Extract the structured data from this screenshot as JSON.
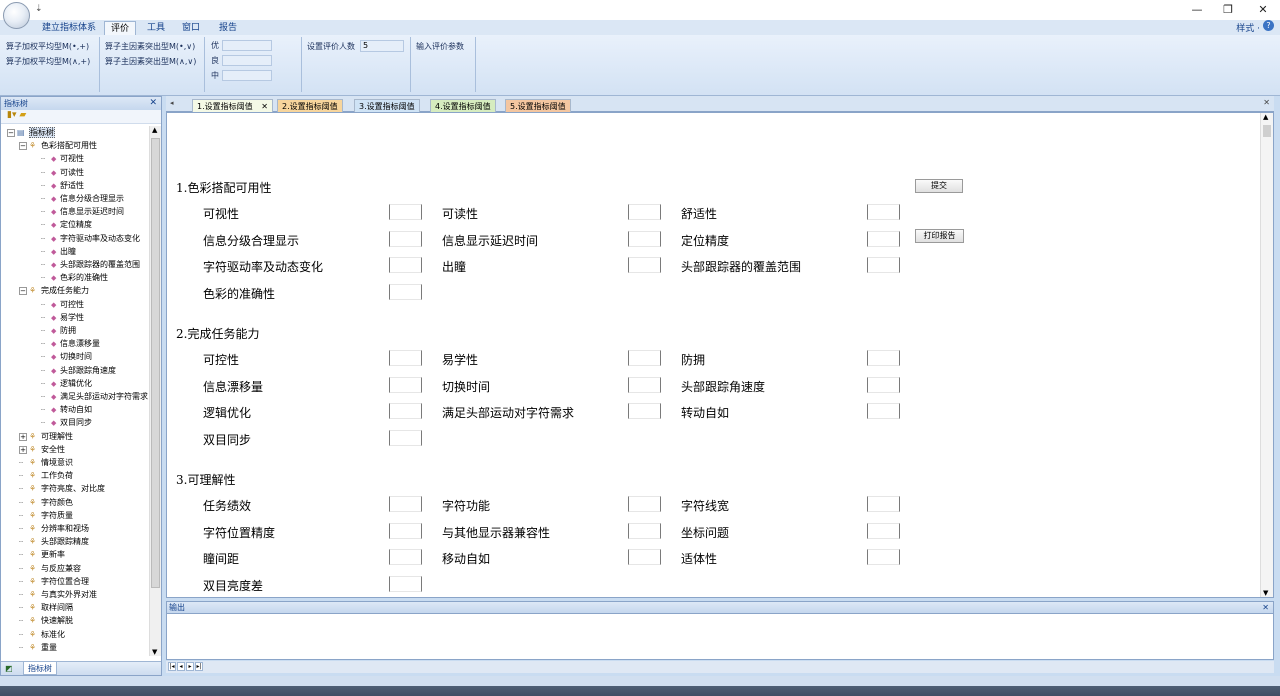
{
  "titlebar": {
    "qat_symbol": "⇣",
    "minimize": "—",
    "maximize": "❐",
    "close": "✕"
  },
  "ribbon_tabs": [
    "建立指标体系",
    "评价",
    "工具",
    "窗口",
    "报告"
  ],
  "style_menu": "样式 ·",
  "help_label": "?",
  "ribbon": {
    "ops": [
      "算子加权平均型M(•,+)",
      "算子加权平均型M(∧,+)",
      "算子主因素突出型M(•,∨)",
      "算子主因素突出型M(∧,∨)"
    ],
    "eval_levels": [
      "优",
      "良",
      "中"
    ],
    "eval_count_label": "设置评价人数",
    "eval_count_value": "5",
    "eval_params": "输入评价参数"
  },
  "left_panel": {
    "title": "指标树",
    "close": "✕",
    "bottom_tab": "指标树",
    "tree": [
      {
        "label": "指标树",
        "level": 0,
        "kind": "root"
      },
      {
        "label": "色彩搭配可用性",
        "level": 1,
        "kind": "group"
      },
      {
        "label": "可视性",
        "level": 2,
        "kind": "leaf"
      },
      {
        "label": "可读性",
        "level": 2,
        "kind": "leaf"
      },
      {
        "label": "舒适性",
        "level": 2,
        "kind": "leaf"
      },
      {
        "label": "信息分级合理显示",
        "level": 2,
        "kind": "leaf"
      },
      {
        "label": "信息显示延迟时间",
        "level": 2,
        "kind": "leaf"
      },
      {
        "label": "定位精度",
        "level": 2,
        "kind": "leaf"
      },
      {
        "label": "字符驱动率及动态变化",
        "level": 2,
        "kind": "leaf"
      },
      {
        "label": "出瞳",
        "level": 2,
        "kind": "leaf"
      },
      {
        "label": "头部跟踪器的覆盖范围",
        "level": 2,
        "kind": "leaf"
      },
      {
        "label": "色彩的准确性",
        "level": 2,
        "kind": "leaf"
      },
      {
        "label": "完成任务能力",
        "level": 1,
        "kind": "group"
      },
      {
        "label": "可控性",
        "level": 2,
        "kind": "leaf"
      },
      {
        "label": "易学性",
        "level": 2,
        "kind": "leaf"
      },
      {
        "label": "防拥",
        "level": 2,
        "kind": "leaf"
      },
      {
        "label": "信息漂移量",
        "level": 2,
        "kind": "leaf"
      },
      {
        "label": "切换时间",
        "level": 2,
        "kind": "leaf"
      },
      {
        "label": "头部跟踪角速度",
        "level": 2,
        "kind": "leaf"
      },
      {
        "label": "逻辑优化",
        "level": 2,
        "kind": "leaf"
      },
      {
        "label": "满足头部运动对字符需求",
        "level": 2,
        "kind": "leaf"
      },
      {
        "label": "转动自如",
        "level": 2,
        "kind": "leaf"
      },
      {
        "label": "双目同步",
        "level": 2,
        "kind": "leaf"
      },
      {
        "label": "可理解性",
        "level": 1,
        "kind": "collapsed"
      },
      {
        "label": "安全性",
        "level": 1,
        "kind": "collapsed"
      },
      {
        "label": "情境意识",
        "level": 1,
        "kind": "plain"
      },
      {
        "label": "工作负荷",
        "level": 1,
        "kind": "plain"
      },
      {
        "label": "字符亮度、对比度",
        "level": 1,
        "kind": "plain"
      },
      {
        "label": "字符颜色",
        "level": 1,
        "kind": "plain"
      },
      {
        "label": "字符质量",
        "level": 1,
        "kind": "plain"
      },
      {
        "label": "分辨率和视场",
        "level": 1,
        "kind": "plain"
      },
      {
        "label": "头部跟踪精度",
        "level": 1,
        "kind": "plain"
      },
      {
        "label": "更新率",
        "level": 1,
        "kind": "plain"
      },
      {
        "label": "与反应兼容",
        "level": 1,
        "kind": "plain"
      },
      {
        "label": "字符位置合理",
        "level": 1,
        "kind": "plain"
      },
      {
        "label": "与真实外界对准",
        "level": 1,
        "kind": "plain"
      },
      {
        "label": "取样间隔",
        "level": 1,
        "kind": "plain"
      },
      {
        "label": "快速解脱",
        "level": 1,
        "kind": "plain"
      },
      {
        "label": "标准化",
        "level": 1,
        "kind": "plain"
      },
      {
        "label": "重量",
        "level": 1,
        "kind": "plain"
      }
    ]
  },
  "doc_tabs": [
    {
      "label": "1.设置指标阈值",
      "color": "#f4f9e6",
      "close": "✕"
    },
    {
      "label": "2.设置指标阈值",
      "color": "#f7d59c"
    },
    {
      "label": "3.设置指标阈值",
      "color": "#cfe3f5"
    },
    {
      "label": "4.设置指标阈值",
      "color": "#d6ecbf"
    },
    {
      "label": "5.设置指标阈值",
      "color": "#f4c6a0"
    }
  ],
  "actions": {
    "submit": "提交",
    "print_report": "打印报告"
  },
  "sections": [
    {
      "title": "1.色彩搭配可用性",
      "rows": [
        [
          "可视性",
          "可读性",
          "舒适性"
        ],
        [
          "信息分级合理显示",
          "信息显示延迟时间",
          "定位精度"
        ],
        [
          "字符驱动率及动态变化",
          "出瞳",
          "头部跟踪器的覆盖范围"
        ],
        [
          "色彩的准确性"
        ]
      ]
    },
    {
      "title": "2.完成任务能力",
      "rows": [
        [
          "可控性",
          "易学性",
          "防拥"
        ],
        [
          "信息漂移量",
          "切换时间",
          "头部跟踪角速度"
        ],
        [
          "逻辑优化",
          "满足头部运动对字符需求",
          "转动自如"
        ],
        [
          "双目同步"
        ]
      ]
    },
    {
      "title": "3.可理解性",
      "rows": [
        [
          "任务绩效",
          "字符功能",
          "字符线宽"
        ],
        [
          "字符位置精度",
          "与其他显示器兼容性",
          "坐标问题"
        ],
        [
          "瞳间距",
          "移动自如",
          "适体性"
        ],
        [
          "双目亮度差"
        ]
      ]
    }
  ],
  "output": {
    "title": "输出",
    "close": "✕"
  },
  "nav_buttons": [
    "|◂",
    "◂",
    "▸",
    "▸|"
  ]
}
